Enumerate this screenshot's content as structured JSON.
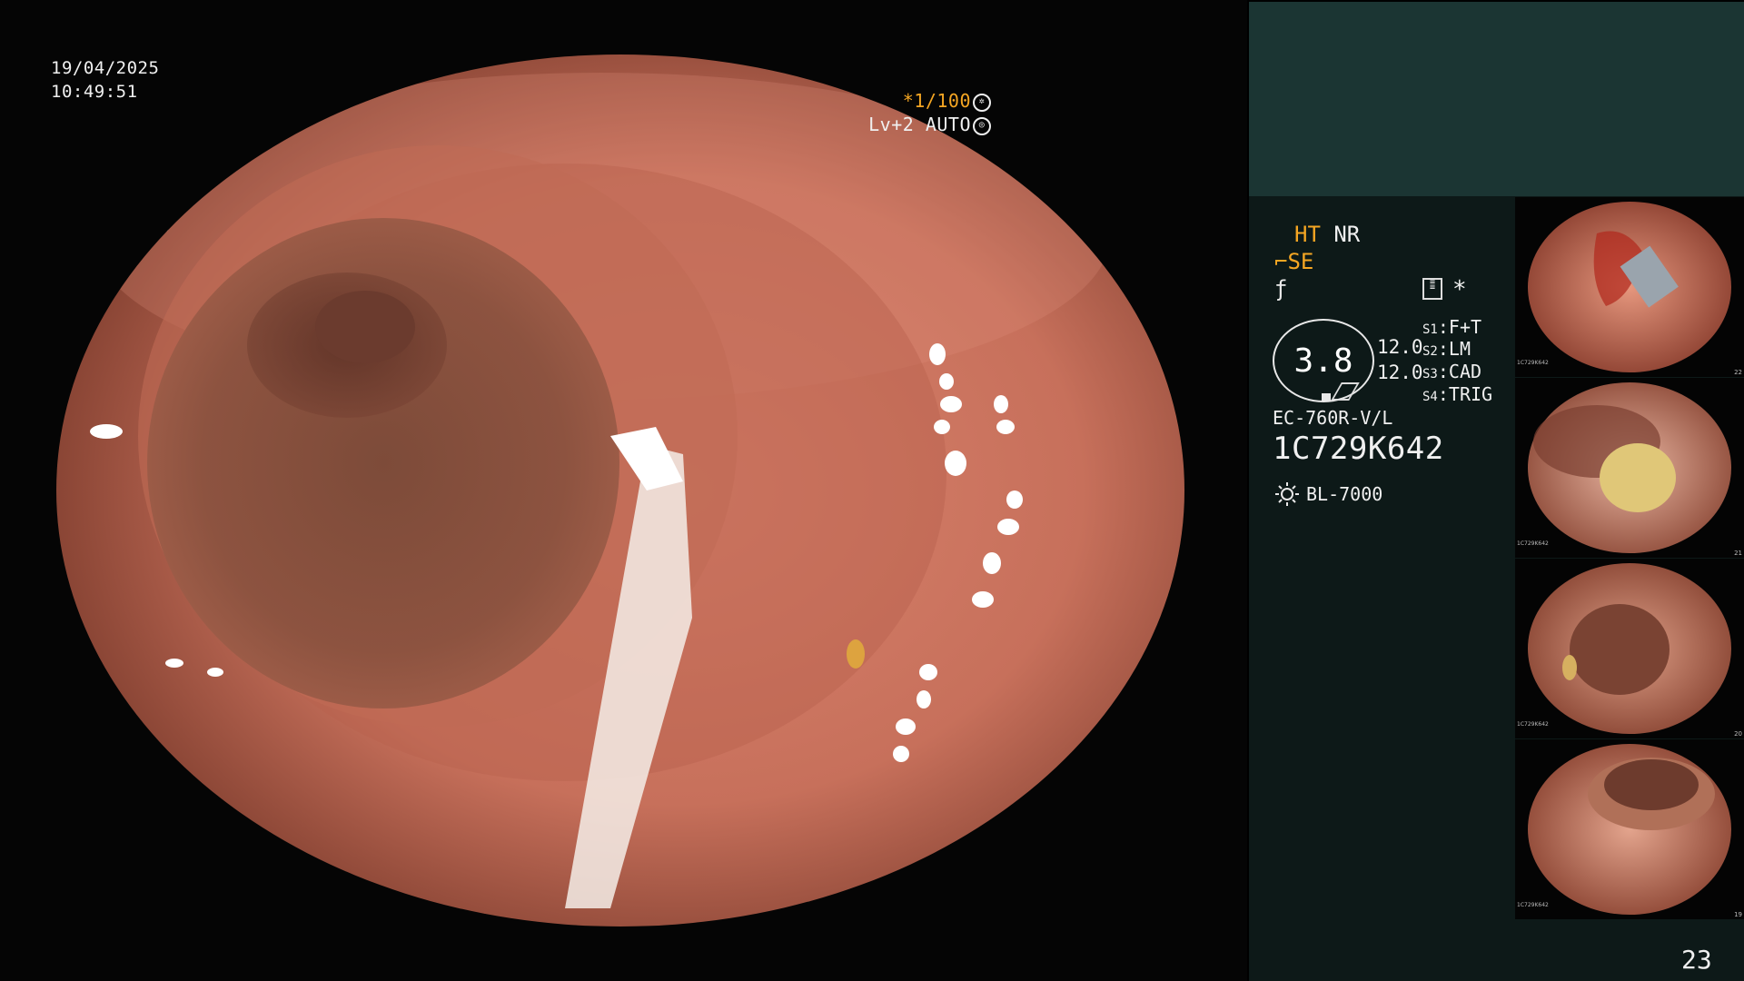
{
  "osd": {
    "date": "19/04/2025",
    "time": "10:49:51",
    "shutter": "*1/100",
    "level": "Lv+2",
    "iris": "AUTO"
  },
  "panel": {
    "mode_ht": "HT",
    "mode_nr": "NR",
    "mode_se_symbol": "⌐",
    "mode_se": "SE",
    "mode_f_symbol": "ƒ",
    "star": "*",
    "enhance_value": "3.8",
    "value_1": "12.0",
    "value_2": "12.0",
    "switches": [
      {
        "key": "S1",
        "value": "F+T"
      },
      {
        "key": "S2",
        "value": "LM"
      },
      {
        "key": "S3",
        "value": "CAD"
      },
      {
        "key": "S4",
        "value": "TRIG"
      }
    ],
    "scope_model": "EC-760R-V/L",
    "scope_serial": "1C729K642",
    "light_source": "BL-7000",
    "page_number": "23"
  },
  "thumbnails": [
    {
      "serial": "1C729K642",
      "index": "22"
    },
    {
      "serial": "1C729K642",
      "index": "21"
    },
    {
      "serial": "1C729K642",
      "index": "20"
    },
    {
      "serial": "1C729K642",
      "index": "19"
    }
  ],
  "colors": {
    "accent_orange": "#f5a623",
    "panel_top": "#1b3533",
    "panel_info": "#0d1918"
  }
}
